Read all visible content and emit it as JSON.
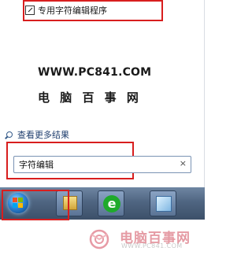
{
  "start_menu": {
    "program_item_label": "专用字符编辑程序",
    "watermark_url": "WWW.PC841.COM",
    "watermark_name": "电 脑 百 事 网",
    "see_more_results": "查看更多结果",
    "search_value": "字符编辑",
    "clear_symbol": "×"
  },
  "taskbar": {
    "ie_letter": "e"
  },
  "logo": {
    "name": "电脑百事网",
    "url": "WWW.PC841.COM"
  }
}
